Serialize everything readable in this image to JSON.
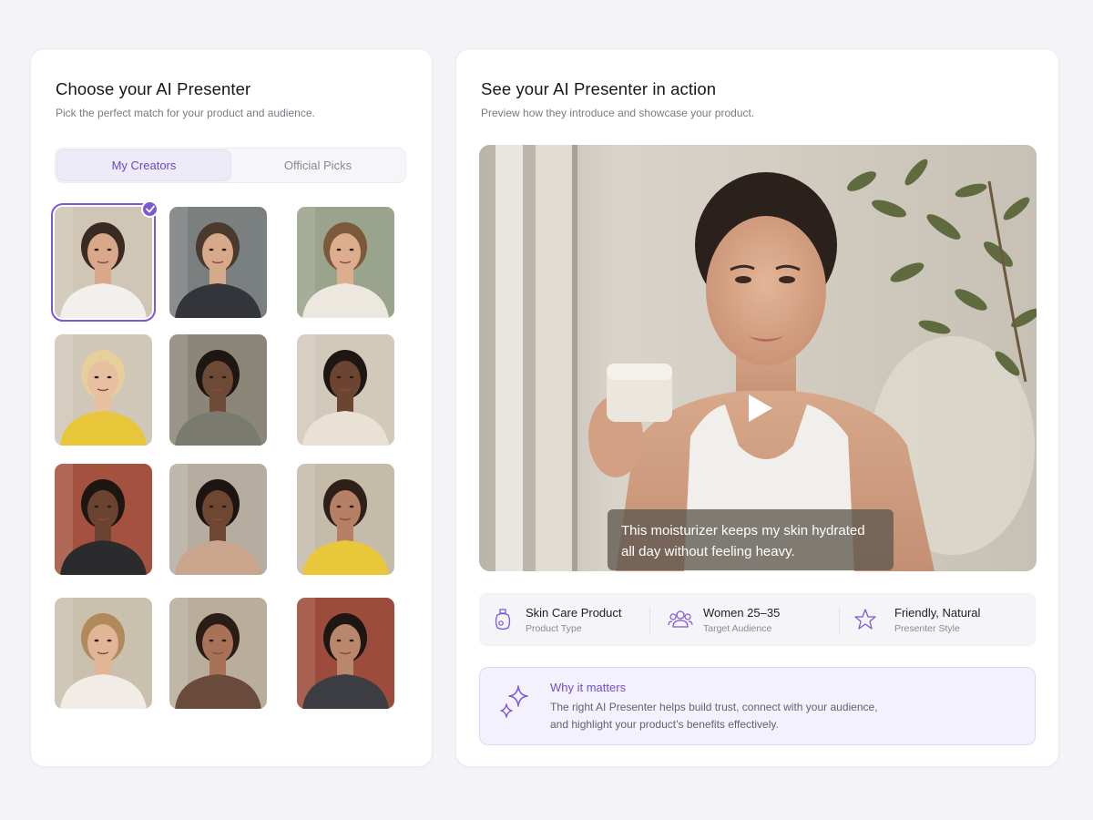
{
  "left_panel": {
    "title": "Choose your AI Presenter",
    "subtitle": "Pick the perfect match for your product and audience.",
    "tabs": [
      {
        "label": "My Creators",
        "active": true
      },
      {
        "label": "Official Picks",
        "active": false
      }
    ],
    "selected_presenter_index": 0
  },
  "right_panel": {
    "title": "See your AI Presenter in action",
    "subtitle": "Preview how they introduce and showcase your product.",
    "video": {
      "caption_line1": "This moisturizer keeps my skin hydrated",
      "caption_line2": "all day without feeling heavy."
    },
    "info": [
      {
        "value": "Skin Care Product",
        "label": "Product Type",
        "icon": "skincare-bottle-icon"
      },
      {
        "value": "Women 25–35",
        "label": "Target Audience",
        "icon": "users-icon"
      },
      {
        "value": "Friendly, Natural",
        "label": "Presenter Style",
        "icon": "star-icon"
      }
    ],
    "why": {
      "title": "Why it matters",
      "line1": "The right AI Presenter helps build trust, connect with your audience,",
      "line2": "and highlight your product’s benefits effectively.",
      "icon": "sparkles-icon"
    }
  },
  "colors": {
    "accent": "#7e57d6",
    "accent_text": "#6c47c8",
    "background": "#f4f3f8"
  }
}
